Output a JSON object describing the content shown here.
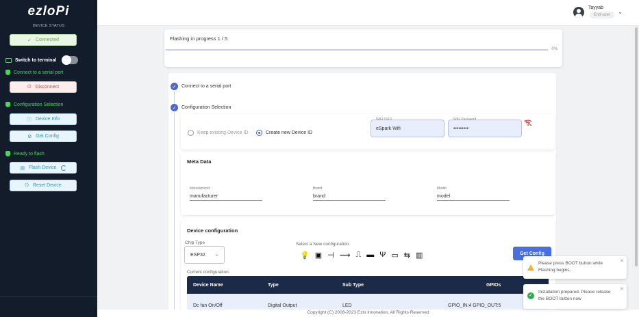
{
  "sidebar": {
    "logo": "ezloPi",
    "device_status": "DEVICE STATUS",
    "connected": "Connected",
    "switch_terminal": "Switch to terminal",
    "connect_serial": "Connect to a serial port",
    "disconnect": "Disconnect",
    "config_selection": "Configuration Selection",
    "device_info": "Device Info",
    "get_config": "Get Config",
    "ready_flash": "Ready to flash",
    "flash_device": "Flash Device",
    "reset_device": "Reset Device"
  },
  "header": {
    "user_name": "Tayyab",
    "user_role": "End-user"
  },
  "flash": {
    "title": "Flashing in progress 1 / 5",
    "percent": "0%",
    "progress_fraction": 0
  },
  "steps": {
    "step1": "Connect to a serial port",
    "step2": "Configuration Selection"
  },
  "config": {
    "keep_existing": "Keep existing Device ID",
    "create_new": "Create new Device ID",
    "wifi_ssid_label": "WiFi SSID",
    "wifi_ssid_value": "eSpark Wifi",
    "wifi_password_label": "WiFi Password",
    "wifi_password_value": "•••••••••"
  },
  "meta": {
    "title": "Meta Data",
    "manufacturer_label": "Manufacturer",
    "manufacturer_value": "manufacturer",
    "brand_label": "Brand",
    "brand_value": "brand",
    "model_label": "Model",
    "model_value": "model"
  },
  "device_config": {
    "title": "Device configuration",
    "chip_type_label": "Chip Type",
    "chip_type_value": "ESP32",
    "new_config_label": "Select a New configuration",
    "get_config_button": "Get Config",
    "current_config_label": "Current configuration",
    "columns": [
      "Device Name",
      "Type",
      "Sub Type",
      "GPIOs"
    ],
    "row": [
      "Dc fan On/Off",
      "Digital Output",
      "LED",
      "GPIO_IN:4 GPIO_OUT:5"
    ]
  },
  "footer": "Copyright (C) 2008-2023 Ezlo Innovation. All Rights Reserved",
  "toasts": [
    {
      "message": "Please press BOOT button while Flashing begins.",
      "type": "warning"
    },
    {
      "message": "Installation prepared. Please release the BOOT button now",
      "type": "success"
    }
  ]
}
